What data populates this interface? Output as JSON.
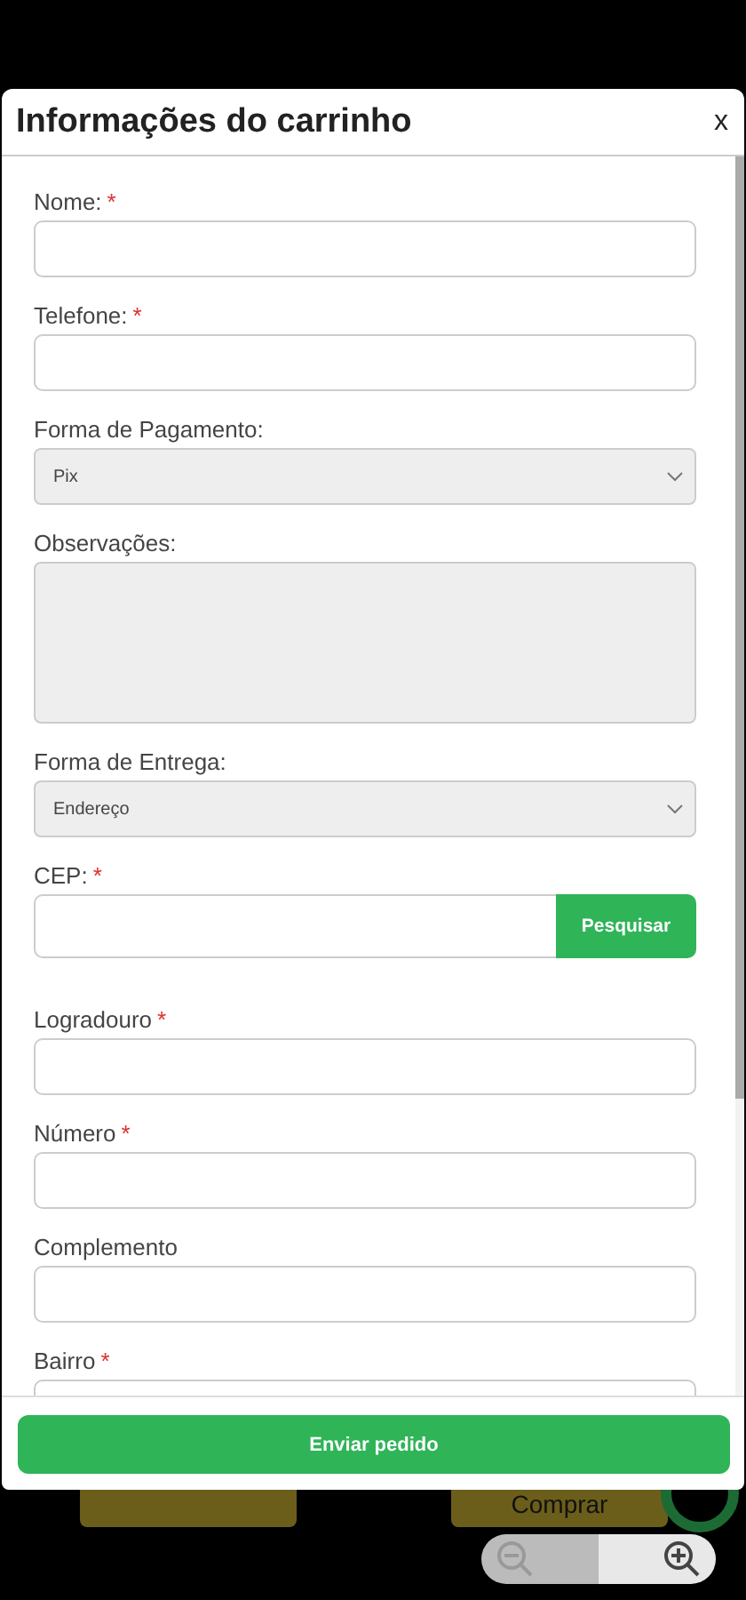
{
  "modal": {
    "title": "Informações do carrinho",
    "close": "x",
    "fields": [
      {
        "kind": "text",
        "label": "Nome:",
        "asterisk": "*"
      },
      {
        "kind": "text",
        "label": "Telefone:",
        "asterisk": "*"
      },
      {
        "kind": "select",
        "label": "Forma de Pagamento:",
        "value": "Pix"
      },
      {
        "kind": "textarea",
        "label": "Observações:"
      },
      {
        "kind": "select",
        "label": "Forma de Entrega:",
        "value": "Endereço"
      },
      {
        "kind": "search",
        "label": "CEP:",
        "asterisk": "*",
        "button": "Pesquisar"
      },
      {
        "kind": "text",
        "label": "Logradouro",
        "asterisk": "*"
      },
      {
        "kind": "text",
        "label": "Número",
        "asterisk": "*"
      },
      {
        "kind": "text",
        "label": "Complemento"
      },
      {
        "kind": "text",
        "label": "Bairro",
        "asterisk": "*"
      }
    ],
    "submit": "Enviar pedido"
  },
  "background": {
    "buttons": [
      {
        "kind": "blank"
      },
      {
        "kind": "labeled",
        "label": "Comprar"
      }
    ]
  }
}
